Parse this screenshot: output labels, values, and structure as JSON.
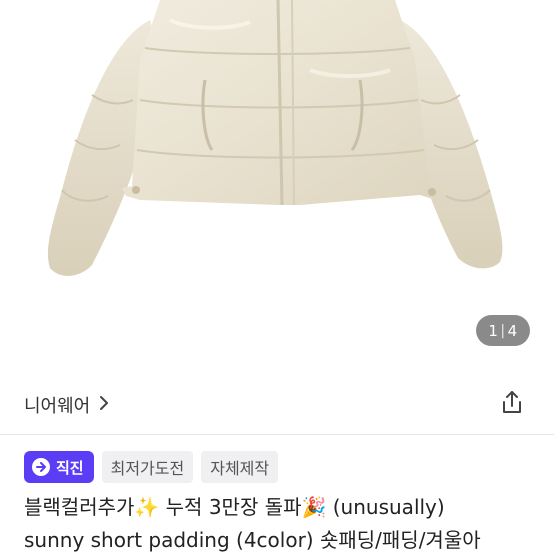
{
  "hero": {
    "image_alt": "Cream puffer short padding jacket",
    "page_current": "1",
    "page_total": "4"
  },
  "brand": {
    "name": "니어웨어",
    "chevron": "chevron-right-icon"
  },
  "share": {
    "icon": "share-icon"
  },
  "badges": {
    "direct": "직진",
    "tags": [
      "최저가도전",
      "자체제작"
    ]
  },
  "product": {
    "title_line1": "블랙컬러추가✨ 누적 3만장 돌파🎉 (unusually)",
    "title_line2": "sunny short padding (4color) 숏패딩/패딩/겨울아"
  },
  "colors": {
    "accent": "#5b3df5",
    "jacket": "#ece6d6",
    "indicator_bg": "#8a8a8a"
  }
}
